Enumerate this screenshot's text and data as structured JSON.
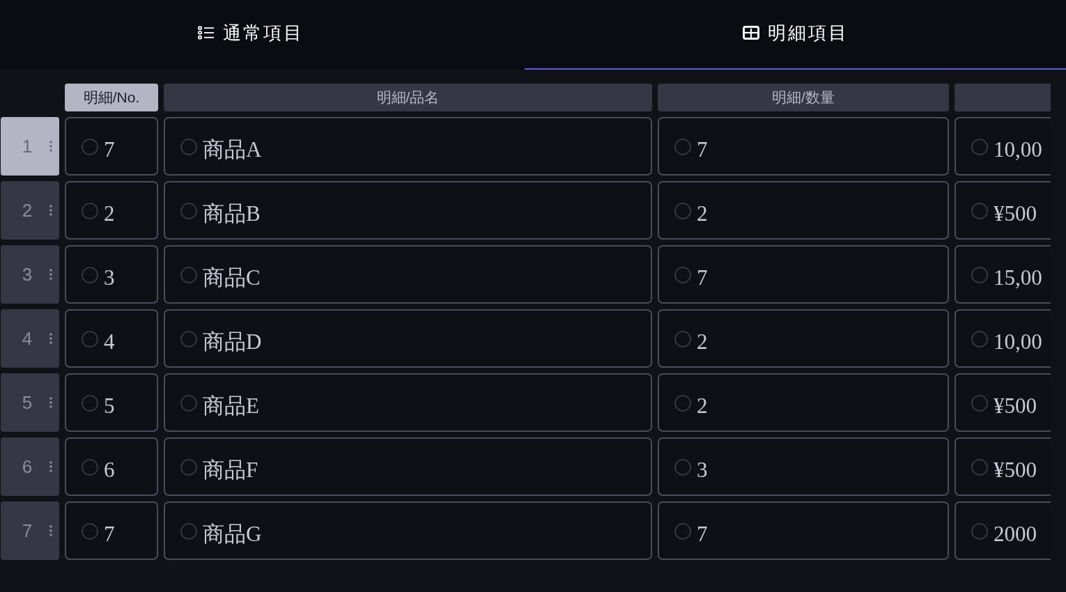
{
  "tabs": [
    {
      "label": "通常項目",
      "selected": false
    },
    {
      "label": "明細項目",
      "selected": true
    }
  ],
  "table": {
    "columns": [
      {
        "label": "明細/No.",
        "selected": true
      },
      {
        "label": "明細/品名",
        "selected": false
      },
      {
        "label": "明細/数量",
        "selected": false
      },
      {
        "selected": false
      }
    ],
    "rows": [
      {
        "number": "1",
        "selected": true,
        "cells": [
          "7",
          "商品A",
          "7",
          "10,00"
        ]
      },
      {
        "number": "2",
        "selected": false,
        "cells": [
          "2",
          "商品B",
          "2",
          "¥500"
        ]
      },
      {
        "number": "3",
        "selected": false,
        "cells": [
          "3",
          "商品C",
          "7",
          "15,00"
        ]
      },
      {
        "number": "4",
        "selected": false,
        "cells": [
          "4",
          "商品D",
          "2",
          "10,00"
        ]
      },
      {
        "number": "5",
        "selected": false,
        "cells": [
          "5",
          "商品E",
          "2",
          "¥500"
        ]
      },
      {
        "number": "6",
        "selected": false,
        "cells": [
          "6",
          "商品F",
          "3",
          "¥500"
        ]
      },
      {
        "number": "7",
        "selected": false,
        "cells": [
          "7",
          "商品G",
          "7",
          "2000"
        ]
      }
    ]
  }
}
